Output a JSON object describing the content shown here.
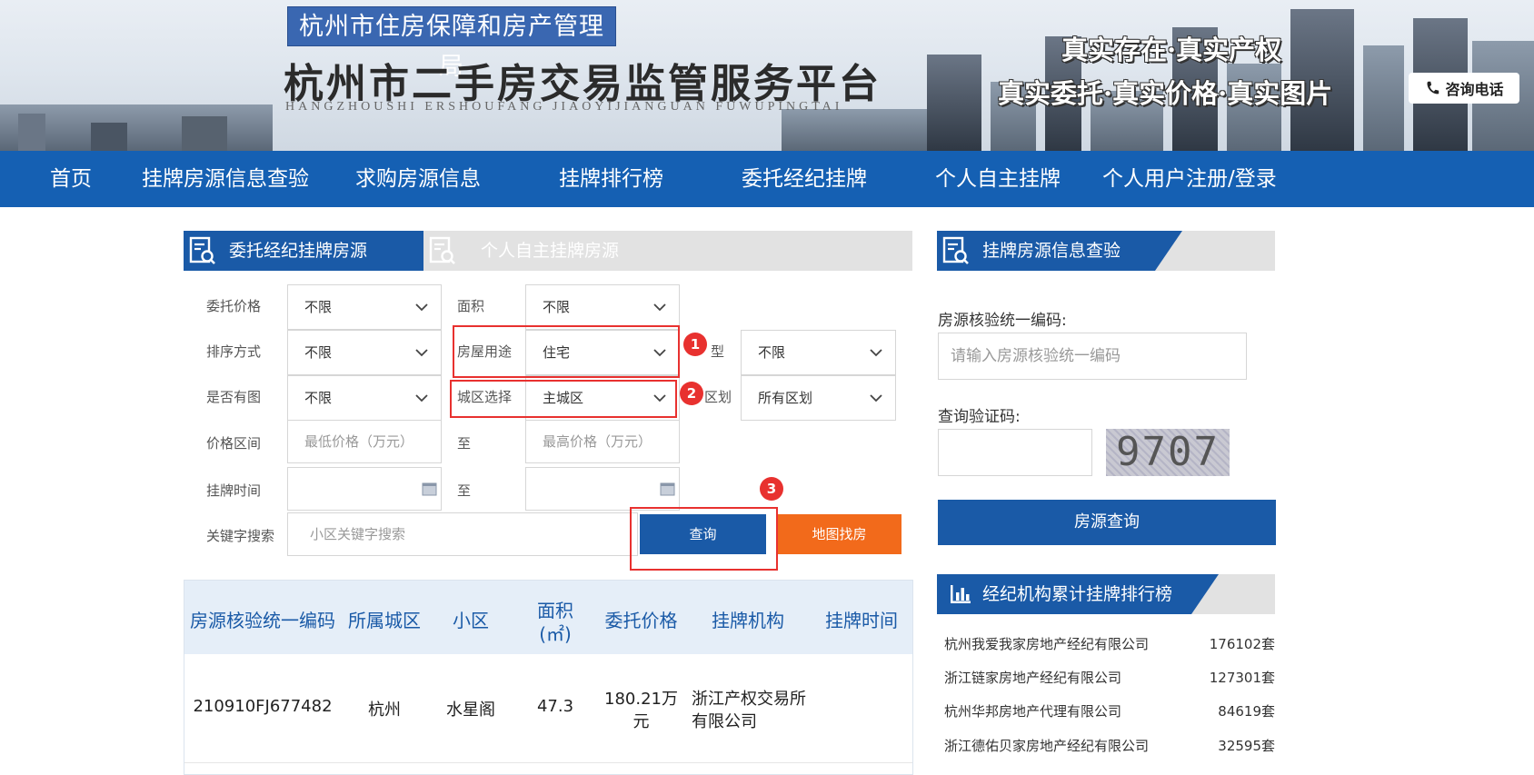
{
  "header": {
    "bureau": "杭州市住房保障和房产管理局",
    "title": "杭州市二手房交易监管服务平台",
    "pinyin": "HANGZHOUSHI  ERSHOUFANG  JIAOYIJIANGUAN  FUWUPINGTAI",
    "slogan_line1": "真实存在·真实产权",
    "slogan_line2": "真实委托·真实价格·真实图片",
    "phone_label": "咨询电话"
  },
  "nav": {
    "items": [
      "首页",
      "挂牌房源信息查验",
      "求购房源信息",
      "挂牌排行榜",
      "委托经纪挂牌",
      "个人自主挂牌",
      "个人用户注册/登录"
    ]
  },
  "tabs": {
    "active": "委托经纪挂牌房源",
    "inactive": "个人自主挂牌房源"
  },
  "form": {
    "price_label": "委托价格",
    "price_value": "不限",
    "area_label": "面积",
    "area_value": "不限",
    "sort_label": "排序方式",
    "sort_value": "不限",
    "usage_label": "房屋用途",
    "usage_value": "住宅",
    "type_label_partial": "型",
    "type_value": "不限",
    "pic_label": "是否有图",
    "pic_value": "不限",
    "city_label": "城区选择",
    "city_value": "主城区",
    "district_label_partial": "区划",
    "district_value": "所有区划",
    "price_range_label": "价格区间",
    "min_price_placeholder": "最低价格（万元）",
    "to_label": "至",
    "max_price_placeholder": "最高价格（万元）",
    "list_time_label": "挂牌时间",
    "keyword_label": "关键字搜索",
    "keyword_placeholder": "小区关键字搜索",
    "search_button": "查询",
    "map_button": "地图找房",
    "step1": "1",
    "step2": "2",
    "step3": "3"
  },
  "table": {
    "headers": [
      "房源核验统一编码",
      "所属城区",
      "小区",
      "面积\n(㎡)",
      "委托价格",
      "挂牌机构",
      "挂牌时间"
    ],
    "header_area_l1": "面积",
    "header_area_l2": "(㎡)",
    "rows": [
      {
        "code": "210910FJ677482",
        "district": "杭州",
        "community": "水星阁",
        "area": "47.3",
        "price_l1": "180.21万",
        "price_l2": "元",
        "agency_l1": "浙江产权交易所",
        "agency_l2": "有限公司",
        "time": ""
      }
    ]
  },
  "right": {
    "query_tab": "挂牌房源信息查验",
    "code_label": "房源核验统一编码:",
    "code_placeholder": "请输入房源核验统一编码",
    "captcha_label": "查询验证码:",
    "captcha_text": "9707",
    "query_button": "房源查询",
    "rank_tab": "经纪机构累计挂牌排行榜",
    "ranking": [
      {
        "name": "杭州我爱我家房地产经纪有限公司",
        "count": "176102套"
      },
      {
        "name": "浙江链家房地产经纪有限公司",
        "count": "127301套"
      },
      {
        "name": "杭州华邦房地产代理有限公司",
        "count": "84619套"
      },
      {
        "name": "浙江德佑贝家房地产经纪有限公司",
        "count": "32595套"
      }
    ]
  },
  "colors": {
    "nav_blue": "#1560b3",
    "tab_blue": "#1a5aa7",
    "map_orange": "#f26a1b",
    "highlight_red": "#e8312f"
  }
}
